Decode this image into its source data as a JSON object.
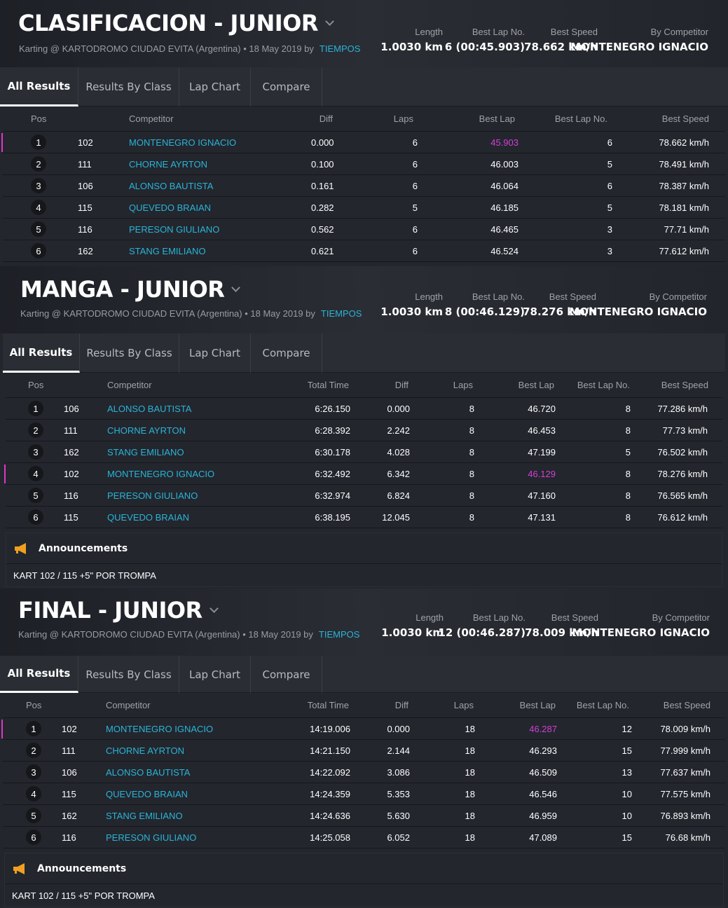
{
  "common": {
    "tabs": [
      "All Results",
      "Results By Class",
      "Lap Chart",
      "Compare"
    ],
    "stat_labels": {
      "length": "Length",
      "best_lap_no": "Best Lap No.",
      "best_speed": "Best Speed",
      "by_competitor": "By Competitor"
    },
    "subtitle": "Karting @ KARTODROMO CIUDAD EVITA (Argentina) • 18 May 2019 by",
    "subtitle_link": "TIEMPOS",
    "accent_color": "#2ab4d8",
    "best_lap_color": "#d23fd6"
  },
  "clasificacion": {
    "title": "CLASIFICACION - JUNIOR",
    "stats": {
      "length": "1.0030 km",
      "best_lap_no": "6 (00:45.903)",
      "best_speed": "78.662 km/h",
      "by_competitor": "MONTENEGRO IGNACIO"
    },
    "columns": [
      "Pos",
      "Competitor",
      "Diff",
      "Laps",
      "Best Lap",
      "Best Lap No.",
      "Best Speed"
    ],
    "rows": [
      {
        "pos": "1",
        "no": "102",
        "name": "MONTENEGRO IGNACIO",
        "diff": "0.000",
        "laps": "6",
        "best": "45.903",
        "bestno": "6",
        "speed": "78.662 km/h"
      },
      {
        "pos": "2",
        "no": "111",
        "name": "CHORNE AYRTON",
        "diff": "0.100",
        "laps": "6",
        "best": "46.003",
        "bestno": "5",
        "speed": "78.491 km/h"
      },
      {
        "pos": "3",
        "no": "106",
        "name": "ALONSO BAUTISTA",
        "diff": "0.161",
        "laps": "6",
        "best": "46.064",
        "bestno": "6",
        "speed": "78.387 km/h"
      },
      {
        "pos": "4",
        "no": "115",
        "name": "QUEVEDO BRAIAN",
        "diff": "0.282",
        "laps": "5",
        "best": "46.185",
        "bestno": "5",
        "speed": "78.181 km/h"
      },
      {
        "pos": "5",
        "no": "116",
        "name": "PERESON GIULIANO",
        "diff": "0.562",
        "laps": "6",
        "best": "46.465",
        "bestno": "3",
        "speed": "77.71 km/h"
      },
      {
        "pos": "6",
        "no": "162",
        "name": "STANG EMILIANO",
        "diff": "0.621",
        "laps": "6",
        "best": "46.524",
        "bestno": "3",
        "speed": "77.612 km/h"
      }
    ]
  },
  "manga": {
    "title": "MANGA - JUNIOR",
    "stats": {
      "length": "1.0030 km",
      "best_lap_no": "8 (00:46.129)",
      "best_speed": "78.276 km/h",
      "by_competitor": "MONTENEGRO IGNACIO"
    },
    "columns": [
      "Pos",
      "Competitor",
      "Total Time",
      "Diff",
      "Laps",
      "Best Lap",
      "Best Lap No.",
      "Best Speed"
    ],
    "rows": [
      {
        "pos": "1",
        "no": "106",
        "name": "ALONSO BAUTISTA",
        "total": "6:26.150",
        "diff": "0.000",
        "laps": "8",
        "best": "46.720",
        "bestno": "8",
        "speed": "77.286 km/h"
      },
      {
        "pos": "2",
        "no": "111",
        "name": "CHORNE AYRTON",
        "total": "6:28.392",
        "diff": "2.242",
        "laps": "8",
        "best": "46.453",
        "bestno": "8",
        "speed": "77.73 km/h"
      },
      {
        "pos": "3",
        "no": "162",
        "name": "STANG EMILIANO",
        "total": "6:30.178",
        "diff": "4.028",
        "laps": "8",
        "best": "47.199",
        "bestno": "5",
        "speed": "76.502 km/h"
      },
      {
        "pos": "4",
        "no": "102",
        "name": "MONTENEGRO IGNACIO",
        "total": "6:32.492",
        "diff": "6.342",
        "laps": "8",
        "best": "46.129",
        "bestno": "8",
        "speed": "78.276 km/h"
      },
      {
        "pos": "5",
        "no": "116",
        "name": "PERESON GIULIANO",
        "total": "6:32.974",
        "diff": "6.824",
        "laps": "8",
        "best": "47.160",
        "bestno": "8",
        "speed": "76.565 km/h"
      },
      {
        "pos": "6",
        "no": "115",
        "name": "QUEVEDO BRAIAN",
        "total": "6:38.195",
        "diff": "12.045",
        "laps": "8",
        "best": "47.131",
        "bestno": "8",
        "speed": "76.612 km/h"
      }
    ],
    "announcements_title": "Announcements",
    "announcement": "KART 102 / 115 +5\" POR TROMPA"
  },
  "final": {
    "title": "FINAL - JUNIOR",
    "stats": {
      "length": "1.0030 km",
      "best_lap_no": "12 (00:46.287)",
      "best_speed": "78.009 km/h",
      "by_competitor": "MONTENEGRO IGNACIO"
    },
    "columns": [
      "Pos",
      "Competitor",
      "Total Time",
      "Diff",
      "Laps",
      "Best Lap",
      "Best Lap No.",
      "Best Speed"
    ],
    "rows": [
      {
        "pos": "1",
        "no": "102",
        "name": "MONTENEGRO IGNACIO",
        "total": "14:19.006",
        "diff": "0.000",
        "laps": "18",
        "best": "46.287",
        "bestno": "12",
        "speed": "78.009 km/h"
      },
      {
        "pos": "2",
        "no": "111",
        "name": "CHORNE AYRTON",
        "total": "14:21.150",
        "diff": "2.144",
        "laps": "18",
        "best": "46.293",
        "bestno": "15",
        "speed": "77.999 km/h"
      },
      {
        "pos": "3",
        "no": "106",
        "name": "ALONSO BAUTISTA",
        "total": "14:22.092",
        "diff": "3.086",
        "laps": "18",
        "best": "46.509",
        "bestno": "13",
        "speed": "77.637 km/h"
      },
      {
        "pos": "4",
        "no": "115",
        "name": "QUEVEDO BRAIAN",
        "total": "14:24.359",
        "diff": "5.353",
        "laps": "18",
        "best": "46.546",
        "bestno": "10",
        "speed": "77.575 km/h"
      },
      {
        "pos": "5",
        "no": "162",
        "name": "STANG EMILIANO",
        "total": "14:24.636",
        "diff": "5.630",
        "laps": "18",
        "best": "46.959",
        "bestno": "10",
        "speed": "76.893 km/h"
      },
      {
        "pos": "6",
        "no": "116",
        "name": "PERESON GIULIANO",
        "total": "14:25.058",
        "diff": "6.052",
        "laps": "18",
        "best": "47.089",
        "bestno": "15",
        "speed": "76.68 km/h"
      }
    ],
    "announcements_title": "Announcements",
    "announcement": "KART 102 / 115 +5\" POR TROMPA"
  }
}
